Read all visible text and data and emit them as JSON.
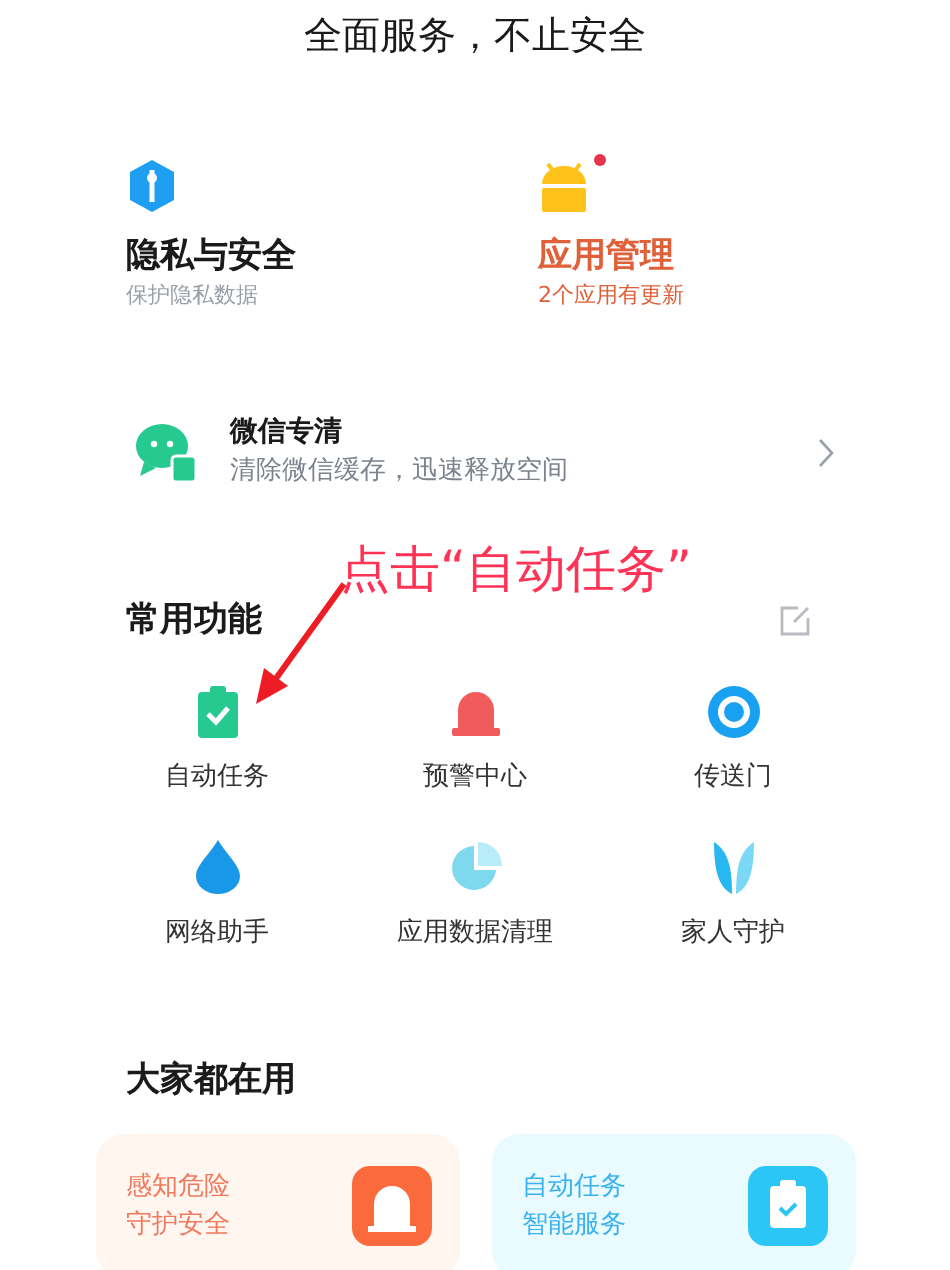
{
  "header": {
    "title": "全面服务，不止安全"
  },
  "features": [
    {
      "title": "隐私与安全",
      "subtitle": "保护隐私数据",
      "color": "#1a1a1a",
      "badge": false
    },
    {
      "title": "应用管理",
      "subtitle": "2个应用有更新",
      "color": "#e0603a",
      "badge": true
    }
  ],
  "wechat": {
    "title": "微信专清",
    "subtitle": "清除微信缓存，迅速释放空间"
  },
  "common": {
    "title": "常用功能",
    "items": [
      {
        "label": "自动任务"
      },
      {
        "label": "预警中心"
      },
      {
        "label": "传送门"
      },
      {
        "label": "网络助手"
      },
      {
        "label": "应用数据清理"
      },
      {
        "label": "家人守护"
      }
    ]
  },
  "annotation": {
    "text": "点击“自动任务”"
  },
  "popular": {
    "title": "大家都在用",
    "cards": [
      {
        "lines": [
          "感知危险",
          "守护安全"
        ],
        "color": "#f07a5e"
      },
      {
        "lines": [
          "自动任务",
          "智能服务"
        ],
        "color": "#3bb2f0"
      }
    ]
  }
}
